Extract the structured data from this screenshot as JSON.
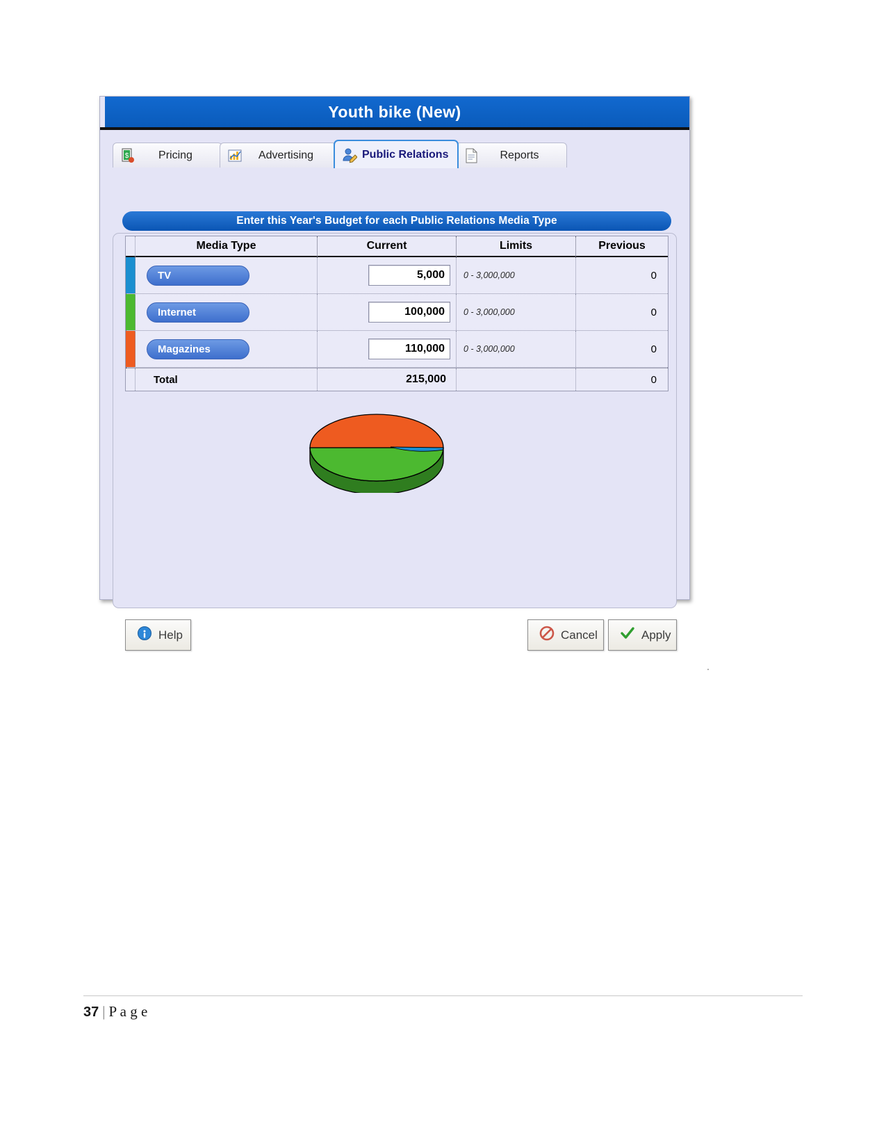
{
  "window": {
    "title": "Youth bike (New)",
    "accent_color": "#0a5bbb"
  },
  "tabs": [
    {
      "label": "Pricing",
      "icon": "pricing-tag-icon",
      "active": false
    },
    {
      "label": "Advertising",
      "icon": "bar-chart-icon",
      "active": false
    },
    {
      "label": "Public Relations",
      "icon": "person-edit-icon",
      "active": true
    },
    {
      "label": "Reports",
      "icon": "document-icon",
      "active": false
    }
  ],
  "banner": {
    "text": "Enter this Year's Budget for each Public Relations Media Type"
  },
  "table": {
    "headers": [
      "Media Type",
      "Current",
      "Limits",
      "Previous"
    ],
    "rows": [
      {
        "media": "TV",
        "current": "5,000",
        "limits": "0 - 3,000,000",
        "previous": "0",
        "color": "#1b8fd0"
      },
      {
        "media": "Internet",
        "current": "100,000",
        "limits": "0 - 3,000,000",
        "previous": "0",
        "color": "#4cb930"
      },
      {
        "media": "Magazines",
        "current": "110,000",
        "limits": "0 - 3,000,000",
        "previous": "0",
        "color": "#ee5b20"
      }
    ],
    "total": {
      "label": "Total",
      "current": "215,000",
      "previous": "0"
    }
  },
  "chart_data": {
    "type": "pie",
    "title": "",
    "categories": [
      "TV",
      "Internet",
      "Magazines"
    ],
    "values": [
      5000,
      100000,
      110000
    ],
    "percentages": [
      2.3,
      46.5,
      51.2
    ],
    "colors": [
      "#1b8fd0",
      "#4cb930",
      "#ee5b20"
    ],
    "legend": "none",
    "style": "3d-pie"
  },
  "buttons": {
    "help": {
      "label": "Help",
      "icon": "info-icon"
    },
    "cancel": {
      "label": "Cancel",
      "icon": "cancel-icon"
    },
    "apply": {
      "label": "Apply",
      "icon": "check-icon"
    }
  },
  "page_footer": {
    "number": "37",
    "separator": "|",
    "label": "P a g e"
  }
}
